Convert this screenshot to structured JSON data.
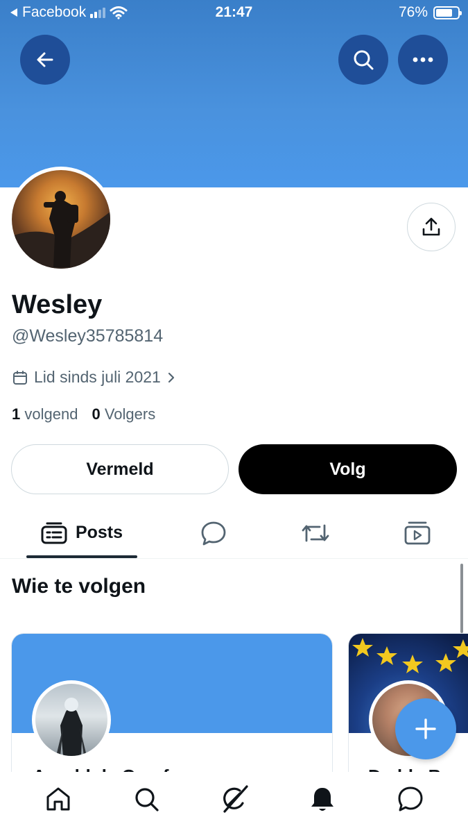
{
  "status_bar": {
    "back_app": "Facebook",
    "time": "21:47",
    "battery_percent": "76%",
    "battery_level": 0.76
  },
  "header": {
    "icons": [
      "back-arrow-icon",
      "search-icon",
      "more-icon"
    ]
  },
  "profile": {
    "display_name": "Wesley",
    "handle": "@Wesley35785814",
    "joined": "Lid sinds juli 2021",
    "following_count": "1",
    "following_label": "volgend",
    "followers_count": "0",
    "followers_label": "Volgers"
  },
  "actions": {
    "mention_label": "Vermeld",
    "follow_label": "Volg"
  },
  "tabs": [
    {
      "label": "Posts",
      "icon": "posts-icon",
      "active": true
    },
    {
      "label": "",
      "icon": "replies-icon",
      "active": false
    },
    {
      "label": "",
      "icon": "repost-icon",
      "active": false
    },
    {
      "label": "",
      "icon": "media-icon",
      "active": false
    }
  ],
  "who_to_follow": {
    "title": "Wie te volgen",
    "cards": [
      {
        "name": "Arnold de Graaf"
      },
      {
        "name": "Dedde B"
      }
    ]
  },
  "bottom_nav": [
    "home-icon",
    "search-icon",
    "grok-icon",
    "notifications-icon",
    "messages-icon"
  ],
  "colors": {
    "banner": "#4b98ea",
    "follow_button": "#000000",
    "fab": "#4b98ea",
    "secondary_text": "#536471"
  }
}
